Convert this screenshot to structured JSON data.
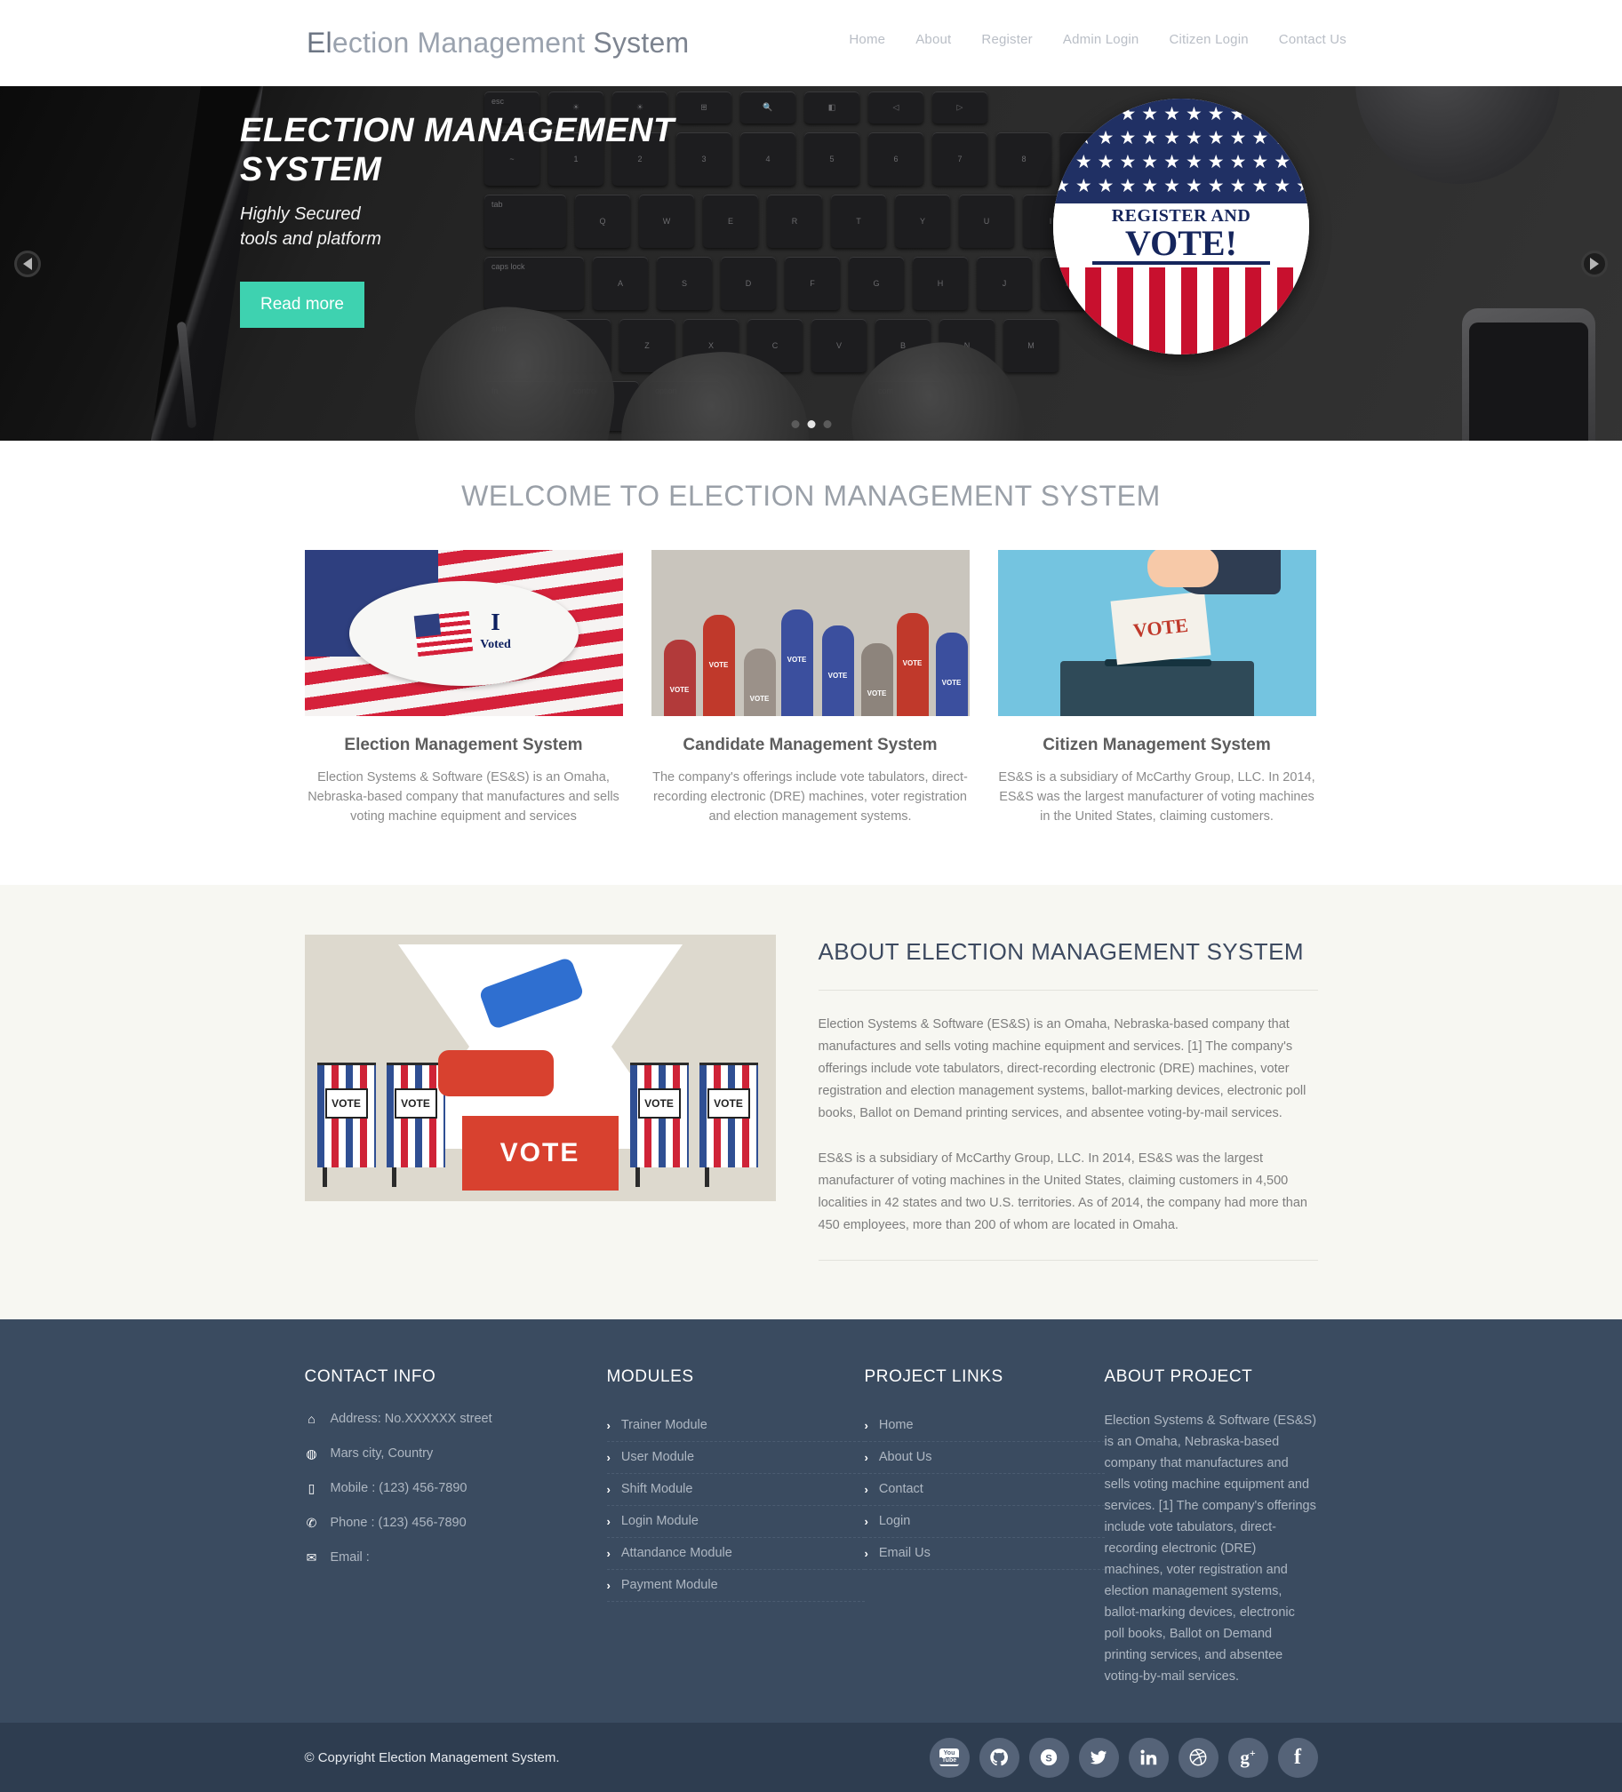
{
  "header": {
    "brand_part1": "El",
    "brand_part2": "ection Management",
    "brand_part3": " System",
    "brand_full": "Election Management System",
    "nav": [
      {
        "label": "Home"
      },
      {
        "label": "About"
      },
      {
        "label": "Register"
      },
      {
        "label": "Admin Login"
      },
      {
        "label": "Citizen Login"
      },
      {
        "label": "Contact Us"
      }
    ]
  },
  "hero": {
    "title": "ELECTION MANAGEMENT SYSTEM",
    "subtitle_line1": "Highly Secured",
    "subtitle_line2": "tools and platform",
    "button_label": "Read more",
    "badge_line1": "REGISTER AND",
    "badge_line2": "VOTE!",
    "prev_icon": "chevron-left-icon",
    "next_icon": "chevron-right-icon",
    "slide_count": 3,
    "active_slide": 2
  },
  "welcome": {
    "title": "WELCOME TO ELECTION MANAGEMENT SYSTEM",
    "cards": [
      {
        "title": "Election Management System",
        "text": "Election Systems & Software (ES&S) is an Omaha, Nebraska-based company that manufactures and sells voting machine equipment and services",
        "image_alt": "i-voted-sticker-flag-image",
        "image_label_line1": "I",
        "image_label_line2": "Voted"
      },
      {
        "title": "Candidate Management System",
        "text": "The company's offerings include vote tabulators, direct-recording electronic (DRE) machines, voter registration and election management systems.",
        "image_alt": "raised-hands-vote-image"
      },
      {
        "title": "Citizen Management System",
        "text": "ES&S is a subsidiary of McCarthy Group, LLC. In 2014, ES&S was the largest manufacturer of voting machines in the United States, claiming customers.",
        "image_alt": "hand-dropping-ballot-into-box-image",
        "image_label": "VOTE"
      }
    ]
  },
  "about": {
    "title": "ABOUT ELECTION MANAGEMENT SYSTEM",
    "paragraph1": "Election Systems & Software (ES&S) is an Omaha, Nebraska-based company that manufactures and sells voting machine equipment and services. [1] The company's offerings include vote tabulators, direct-recording electronic (DRE) machines, voter registration and election management systems, ballot-marking devices, electronic poll books, Ballot on Demand printing services, and absentee voting-by-mail services.",
    "paragraph2": "ES&S is a subsidiary of McCarthy Group, LLC. In 2014, ES&S was the largest manufacturer of voting machines in the United States, claiming customers in 4,500 localities in 42 states and two U.S. territories. As of 2014, the company had more than 450 employees, more than 200 of whom are located in Omaha.",
    "image_alt": "voting-booths-ballot-box-illustration",
    "image_booth_label": "VOTE",
    "image_box_label": "VOTE"
  },
  "footer": {
    "contact": {
      "heading": "CONTACT INFO",
      "items": [
        {
          "icon": "home-icon",
          "text": "Address: No.XXXXXX street"
        },
        {
          "icon": "globe-icon",
          "text": "Mars city, Country"
        },
        {
          "icon": "mobile-icon",
          "text": "Mobile : (123) 456-7890"
        },
        {
          "icon": "phone-icon",
          "text": "Phone : (123) 456-7890"
        },
        {
          "icon": "envelope-icon",
          "text": "Email :"
        }
      ]
    },
    "modules": {
      "heading": "MODULES",
      "items": [
        {
          "label": "Trainer Module"
        },
        {
          "label": "User Module"
        },
        {
          "label": "Shift Module"
        },
        {
          "label": "Login Module"
        },
        {
          "label": "Attandance Module"
        },
        {
          "label": "Payment Module"
        }
      ]
    },
    "project_links": {
      "heading": "PROJECT LINKS",
      "items": [
        {
          "label": "Home"
        },
        {
          "label": "About Us"
        },
        {
          "label": "Contact"
        },
        {
          "label": "Login"
        },
        {
          "label": "Email Us"
        }
      ]
    },
    "about_project": {
      "heading": "ABOUT PROJECT",
      "text": "Election Systems & Software (ES&S) is an Omaha, Nebraska-based company that manufactures and sells voting machine equipment and services. [1] The company's offerings include vote tabulators, direct-recording electronic (DRE) machines, voter registration and election management systems, ballot-marking devices, electronic poll books, Ballot on Demand printing services, and absentee voting-by-mail services."
    },
    "bottom": {
      "copyright": "© Copyright Election Management System.",
      "socials": [
        {
          "name": "youtube-icon",
          "glyph": "You"
        },
        {
          "name": "github-icon",
          "glyph": ""
        },
        {
          "name": "skype-icon",
          "glyph": "S"
        },
        {
          "name": "twitter-icon",
          "glyph": ""
        },
        {
          "name": "linkedin-icon",
          "glyph": "in"
        },
        {
          "name": "dribbble-icon",
          "glyph": ""
        },
        {
          "name": "google-plus-icon",
          "glyph": "g+"
        },
        {
          "name": "facebook-icon",
          "glyph": "f"
        }
      ]
    }
  },
  "colors": {
    "accent_teal": "#3ed2b0",
    "footer_bg": "#3a4b60",
    "bottom_bar_bg": "#2e3d50",
    "about_bg": "#f7f7f2",
    "heading_blue": "#3d4a60"
  }
}
